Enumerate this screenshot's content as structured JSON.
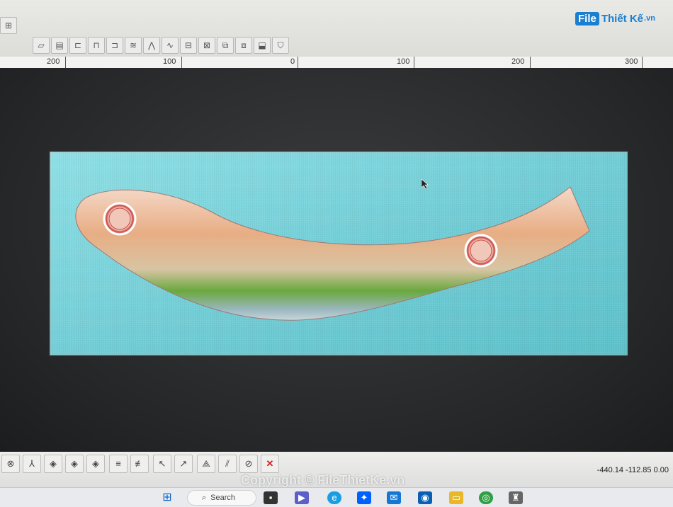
{
  "logo": {
    "mark": "File",
    "name": "Thiết Kế",
    "suffix": ".vn"
  },
  "ruler": {
    "labels": [
      "200",
      "100",
      "0",
      "100",
      "200",
      "300"
    ]
  },
  "coords": "-440.14 -112.85 0.00",
  "watermark": "Copyright © FileThietKe.vn",
  "taskbar": {
    "search_label": "Search"
  },
  "colors": {
    "canvas_bg": "#6fcbd4",
    "part_top": "#e9b38f",
    "part_green": "#6aa83e",
    "workspace": "#252728"
  },
  "icons": {
    "top_toolbar": [
      "plane-icon",
      "box-icon",
      "cylinder-icon",
      "extrude-icon",
      "revolve-icon",
      "sweep-icon",
      "loft-icon",
      "spline-icon",
      "mesh-icon",
      "mirror-icon",
      "array-icon",
      "group-icon",
      "shell-icon",
      "shield-icon"
    ],
    "bottom_toolbar": [
      "snap-icon",
      "axis-icon",
      "diamond-icon",
      "diamond-icon",
      "diamond-icon",
      "layers-icon",
      "layers-edit-icon",
      "select-icon",
      "deselect-icon",
      "transform-icon",
      "align-icon",
      "cross-section-icon",
      "delete-icon"
    ]
  }
}
